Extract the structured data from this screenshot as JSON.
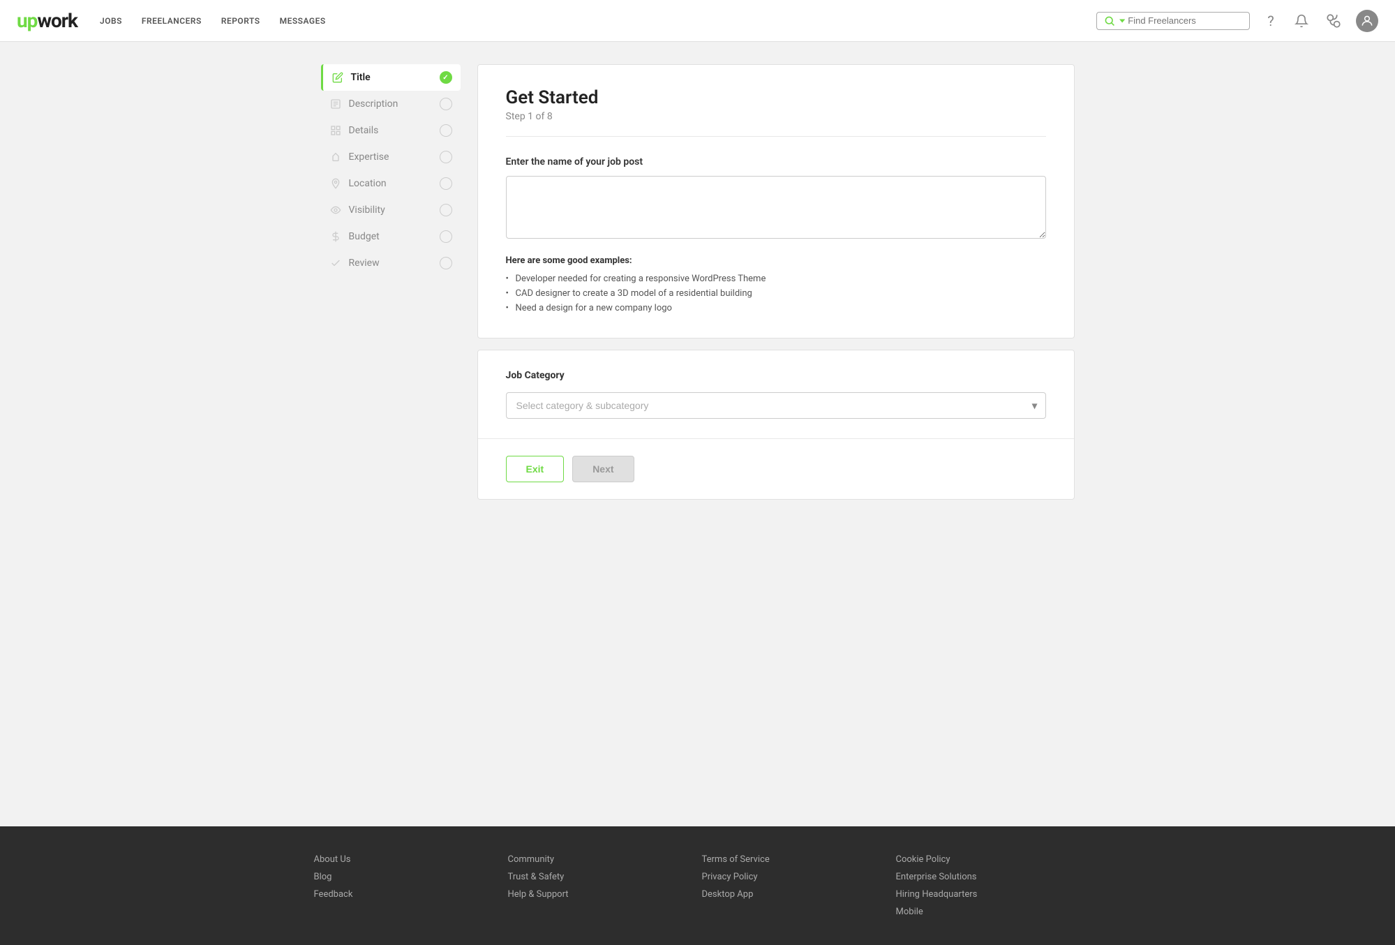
{
  "header": {
    "logo_green": "up",
    "logo_dark": "work",
    "nav": [
      {
        "label": "JOBS",
        "href": "#"
      },
      {
        "label": "FREELANCERS",
        "href": "#"
      },
      {
        "label": "REPORTS",
        "href": "#"
      },
      {
        "label": "MESSAGES",
        "href": "#"
      }
    ],
    "search_placeholder": "Find Freelancers"
  },
  "sidebar": {
    "items": [
      {
        "id": "title",
        "label": "Title",
        "active": true
      },
      {
        "id": "description",
        "label": "Description",
        "active": false
      },
      {
        "id": "details",
        "label": "Details",
        "active": false
      },
      {
        "id": "expertise",
        "label": "Expertise",
        "active": false
      },
      {
        "id": "location",
        "label": "Location",
        "active": false
      },
      {
        "id": "visibility",
        "label": "Visibility",
        "active": false
      },
      {
        "id": "budget",
        "label": "Budget",
        "active": false
      },
      {
        "id": "review",
        "label": "Review",
        "active": false
      }
    ]
  },
  "main": {
    "card_title": "Get Started",
    "card_subtitle": "Step 1 of 8",
    "job_name_label": "Enter the name of your job post",
    "job_name_placeholder": "",
    "examples_title": "Here are some good examples:",
    "examples": [
      "Developer needed for creating a responsive WordPress Theme",
      "CAD designer to create a 3D model of a residential building",
      "Need a design for a new company logo"
    ],
    "category_label": "Job Category",
    "category_placeholder": "Select category & subcategory",
    "btn_exit": "Exit",
    "btn_next": "Next"
  },
  "footer": {
    "columns": [
      {
        "links": [
          "About Us",
          "Blog",
          "Feedback"
        ]
      },
      {
        "links": [
          "Community",
          "Trust & Safety",
          "Help & Support"
        ]
      },
      {
        "links": [
          "Terms of Service",
          "Privacy Policy",
          "Desktop App"
        ]
      },
      {
        "links": [
          "Cookie Policy",
          "Enterprise Solutions",
          "Hiring Headquarters",
          "Mobile"
        ]
      }
    ]
  }
}
